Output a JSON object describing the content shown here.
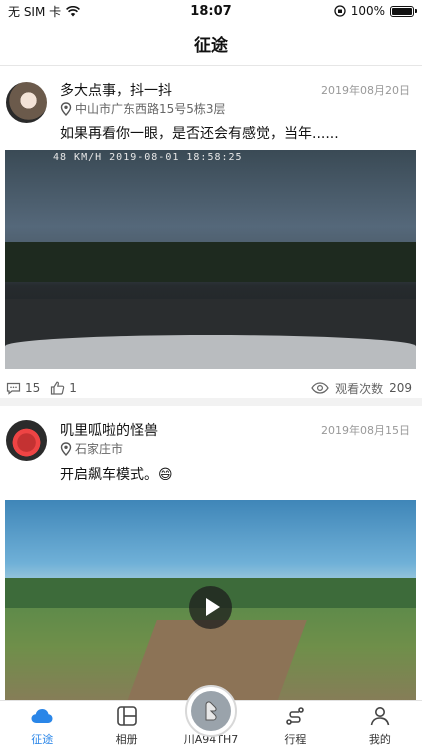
{
  "status_bar": {
    "carrier": "无 SIM 卡",
    "time": "18:07",
    "battery": "100%"
  },
  "nav": {
    "title": "征途"
  },
  "posts": [
    {
      "username": "多大点事，抖一抖",
      "date": "2019年08月20日",
      "location": "中山市广东西路15号5栋3层",
      "text": "如果再看你一眼，是否还会有感觉，当年......",
      "video_overlay": "48 KM/H        2019-08-01  18:58:25",
      "comments": "15",
      "likes": "1",
      "views_label": "观看次数",
      "views": "209"
    },
    {
      "username": "叽里呱啦的怪兽",
      "date": "2019年08月15日",
      "location": "石家庄市",
      "text": "开启飙车模式。😄"
    }
  ],
  "tabs": [
    {
      "label": "征途",
      "icon": "cloud-icon",
      "active": true
    },
    {
      "label": "相册",
      "icon": "album-icon",
      "active": false
    },
    {
      "label": "川A94TH7",
      "icon": "peugeot-logo-icon",
      "active": false
    },
    {
      "label": "行程",
      "icon": "route-icon",
      "active": false
    },
    {
      "label": "我的",
      "icon": "user-icon",
      "active": false
    }
  ],
  "colors": {
    "accent": "#2a86e8",
    "text": "#111111",
    "muted": "#999999"
  }
}
